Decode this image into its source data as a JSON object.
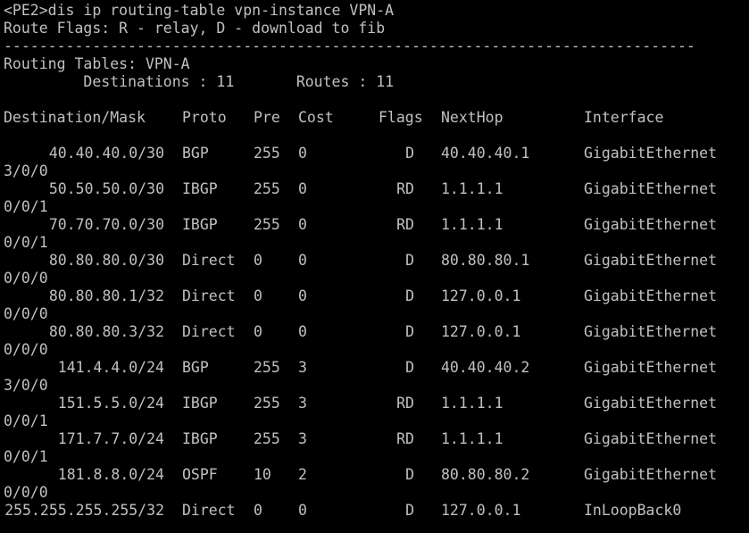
{
  "terminal": {
    "prompt_line": "<PE2>dis ip routing-table vpn-instance VPN-A",
    "flags_legend": "Route Flags: R - relay, D - download to fib",
    "separator": "------------------------------------------------------------------------------",
    "tables_title": "Routing Tables: VPN-A",
    "summary": "         Destinations : 11       Routes : 11",
    "headers": {
      "destination": "Destination/Mask",
      "proto": "Proto",
      "pre": "Pre",
      "cost": "Cost",
      "flags": "Flags",
      "nexthop": "NextHop",
      "interface": "Interface"
    },
    "routes": [
      {
        "dest": "40.40.40.0/30",
        "proto": "BGP",
        "pre": "255",
        "cost": "0",
        "flags": "D",
        "nexthop": "40.40.40.1",
        "iface": "GigabitEthernet",
        "iface_wrap": "3/0/0"
      },
      {
        "dest": "50.50.50.0/30",
        "proto": "IBGP",
        "pre": "255",
        "cost": "0",
        "flags": "RD",
        "nexthop": "1.1.1.1",
        "iface": "GigabitEthernet",
        "iface_wrap": "0/0/1"
      },
      {
        "dest": "70.70.70.0/30",
        "proto": "IBGP",
        "pre": "255",
        "cost": "0",
        "flags": "RD",
        "nexthop": "1.1.1.1",
        "iface": "GigabitEthernet",
        "iface_wrap": "0/0/1"
      },
      {
        "dest": "80.80.80.0/30",
        "proto": "Direct",
        "pre": "0",
        "cost": "0",
        "flags": "D",
        "nexthop": "80.80.80.1",
        "iface": "GigabitEthernet",
        "iface_wrap": "0/0/0"
      },
      {
        "dest": "80.80.80.1/32",
        "proto": "Direct",
        "pre": "0",
        "cost": "0",
        "flags": "D",
        "nexthop": "127.0.0.1",
        "iface": "GigabitEthernet",
        "iface_wrap": "0/0/0"
      },
      {
        "dest": "80.80.80.3/32",
        "proto": "Direct",
        "pre": "0",
        "cost": "0",
        "flags": "D",
        "nexthop": "127.0.0.1",
        "iface": "GigabitEthernet",
        "iface_wrap": "0/0/0"
      },
      {
        "dest": "141.4.4.0/24",
        "proto": "BGP",
        "pre": "255",
        "cost": "3",
        "flags": "D",
        "nexthop": "40.40.40.2",
        "iface": "GigabitEthernet",
        "iface_wrap": "3/0/0"
      },
      {
        "dest": "151.5.5.0/24",
        "proto": "IBGP",
        "pre": "255",
        "cost": "3",
        "flags": "RD",
        "nexthop": "1.1.1.1",
        "iface": "GigabitEthernet",
        "iface_wrap": "0/0/1"
      },
      {
        "dest": "171.7.7.0/24",
        "proto": "IBGP",
        "pre": "255",
        "cost": "3",
        "flags": "RD",
        "nexthop": "1.1.1.1",
        "iface": "GigabitEthernet",
        "iface_wrap": "0/0/1"
      },
      {
        "dest": "181.8.8.0/24",
        "proto": "OSPF",
        "pre": "10",
        "cost": "2",
        "flags": "D",
        "nexthop": "80.80.80.2",
        "iface": "GigabitEthernet",
        "iface_wrap": "0/0/0"
      },
      {
        "dest": "255.255.255.255/32",
        "proto": "Direct",
        "pre": "0",
        "cost": "0",
        "flags": "D",
        "nexthop": "127.0.0.1",
        "iface": "InLoopBack0",
        "iface_wrap": ""
      }
    ]
  }
}
